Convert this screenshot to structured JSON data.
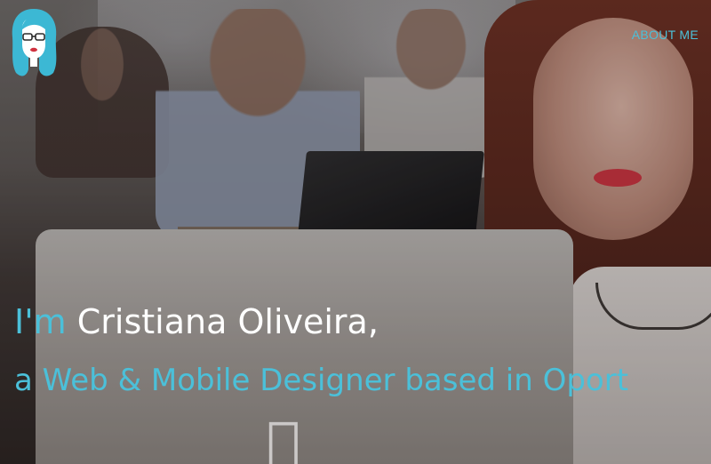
{
  "nav": {
    "about_label": "ABOUT ME"
  },
  "hero": {
    "greeting": "I'm",
    "name": "Cristiana Oliveira,",
    "tagline": "a Web & Mobile Designer based in Oport"
  },
  "icons": {
    "logo": "avatar-logo-icon",
    "laptop_brand": "apple-logo-icon"
  },
  "colors": {
    "accent": "#4bc0d9",
    "name_text": "#ffffff"
  }
}
